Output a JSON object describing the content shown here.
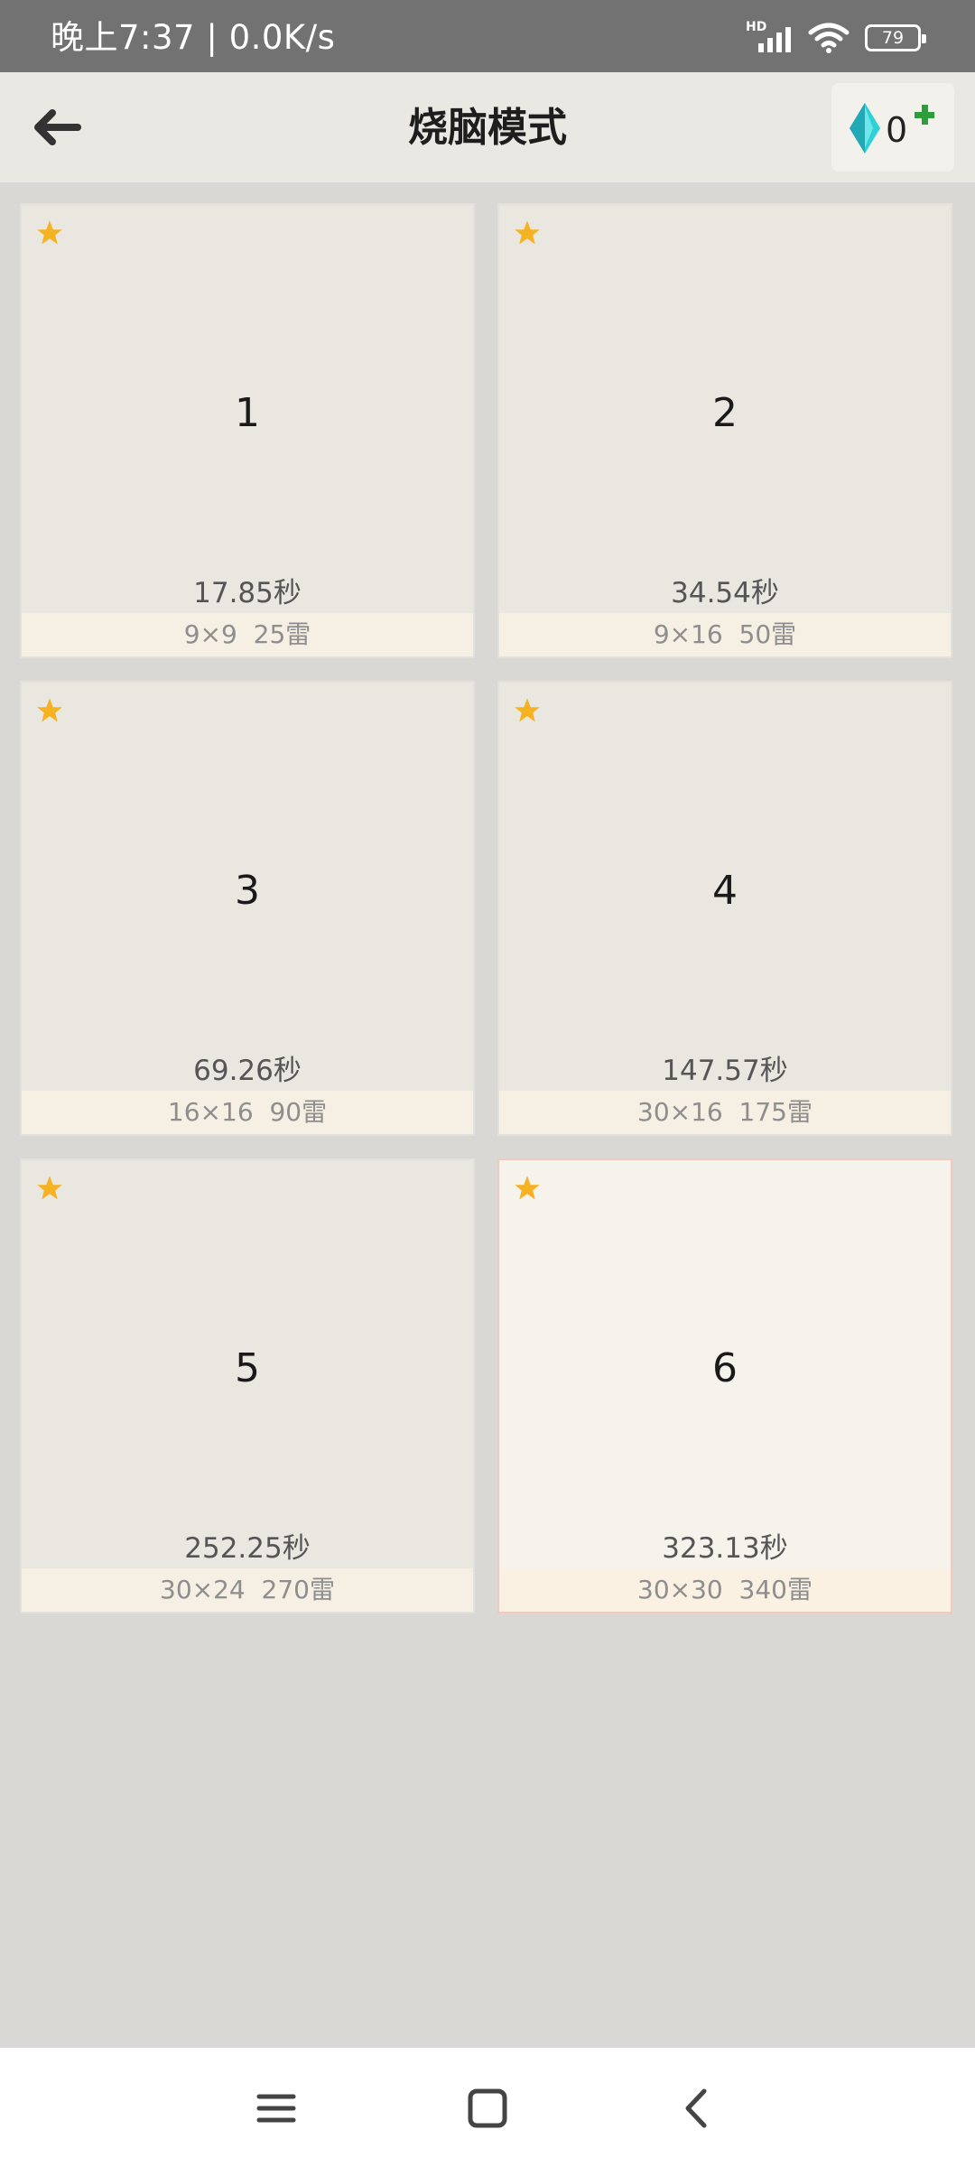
{
  "status": {
    "time": "晚上7:37 | 0.0K/s",
    "network": "HD",
    "battery": "79"
  },
  "header": {
    "back_icon": "arrow-left-icon",
    "title": "烧脑模式",
    "gem_icon": "diamond-icon",
    "gem_count": "0",
    "add_icon": "plus-icon"
  },
  "levels": [
    {
      "number": "1",
      "time": "17.85秒",
      "meta": "9×9  25雷",
      "starred": true
    },
    {
      "number": "2",
      "time": "34.54秒",
      "meta": "9×16  50雷",
      "starred": true
    },
    {
      "number": "3",
      "time": "69.26秒",
      "meta": "16×16  90雷",
      "starred": true
    },
    {
      "number": "4",
      "time": "147.57秒",
      "meta": "30×16  175雷",
      "starred": true
    },
    {
      "number": "5",
      "time": "252.25秒",
      "meta": "30×24  270雷",
      "starred": true
    },
    {
      "number": "6",
      "time": "323.13秒",
      "meta": "30×30  340雷",
      "starred": true
    }
  ],
  "colors": {
    "star": "#f5b324",
    "gem": "#2fd0d6",
    "plus": "#2e9e3a",
    "active_border": "#f0c9c0"
  },
  "nav": {
    "menu_icon": "menu-icon",
    "home_icon": "square-home-icon",
    "back_icon": "chevron-left-icon"
  }
}
